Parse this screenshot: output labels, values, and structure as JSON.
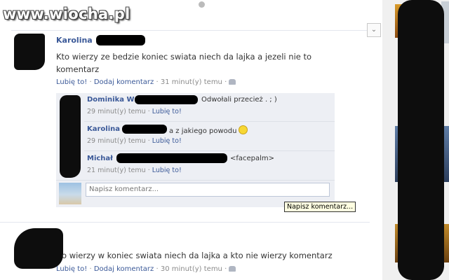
{
  "watermark": "www.wiocha.pl",
  "post1": {
    "author": "Karolina",
    "text_line1": "Kto wierzy ze bedzie koniec swiata niech da lajka a jezeli nie to",
    "text_line2": "komentarz",
    "like": "Lubię to!",
    "comment": "Dodaj komentarz",
    "time": "31 minut(y) temu",
    "sep": "·"
  },
  "comments": [
    {
      "author": "Dominika W",
      "text": "Odwołali przecież . ; )",
      "time": "29 minut(y) temu",
      "like": "Lubię to!"
    },
    {
      "author": "Karolina",
      "text": "a z jakiego powodu",
      "time": "29 minut(y) temu",
      "like": "Lubię to!"
    },
    {
      "author": "Michał",
      "text": "<facepalm>",
      "time": "21 minut(y) temu",
      "like": "Lubię to!"
    }
  ],
  "comment_box": {
    "placeholder": "Napisz komentarz...",
    "tooltip": "Napisz komentarz..."
  },
  "post2": {
    "text": "o wierzy w koniec swiata niech da lajka a kto nie wierzy komentarz",
    "like": "Lubię to!",
    "comment": "Dodaj komentarz",
    "time": "30 minut(y) temu",
    "sep": "·"
  },
  "icons": [
    "globe-icon",
    "chevron-down-icon",
    "people-icon",
    "smile-icon"
  ],
  "colors": {
    "link": "#3b5998",
    "thread_bg": "#edeff4",
    "tooltip_bg": "#ffffe1"
  }
}
